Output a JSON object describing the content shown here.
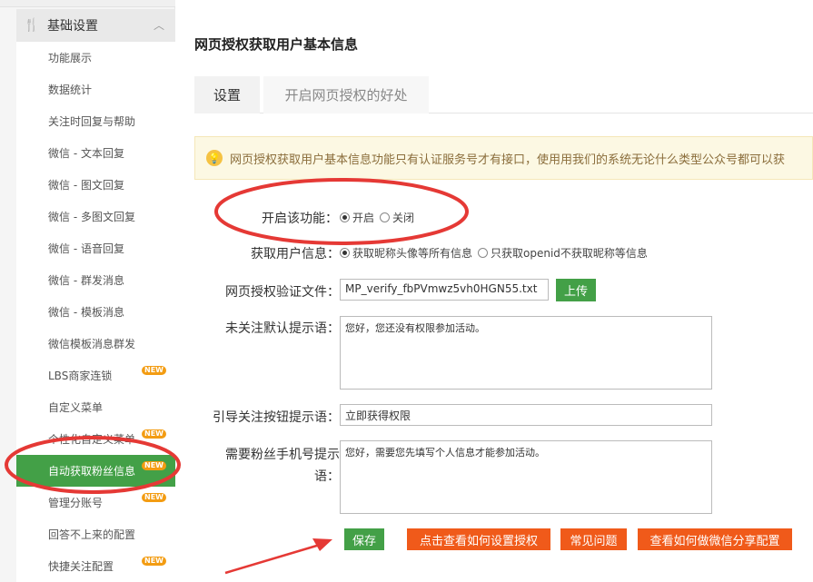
{
  "sidebar": {
    "header_label": "基础设置",
    "items": [
      {
        "label": "功能展示",
        "new": false
      },
      {
        "label": "数据统计",
        "new": false
      },
      {
        "label": "关注时回复与帮助",
        "new": false
      },
      {
        "label": "微信 - 文本回复",
        "new": false
      },
      {
        "label": "微信 - 图文回复",
        "new": false
      },
      {
        "label": "微信 - 多图文回复",
        "new": false
      },
      {
        "label": "微信 - 语音回复",
        "new": false
      },
      {
        "label": "微信 - 群发消息",
        "new": false
      },
      {
        "label": "微信 - 模板消息",
        "new": false
      },
      {
        "label": "微信模板消息群发",
        "new": false
      },
      {
        "label": "LBS商家连锁",
        "new": true
      },
      {
        "label": "自定义菜单",
        "new": false
      },
      {
        "label": "个性化自定义菜单",
        "new": true
      },
      {
        "label": "自动获取粉丝信息",
        "new": true,
        "active": true
      },
      {
        "label": "管理分账号",
        "new": true
      },
      {
        "label": "回答不上来的配置",
        "new": false
      },
      {
        "label": "快捷关注配置",
        "new": true
      }
    ],
    "new_badge": "NEW"
  },
  "main": {
    "title": "网页授权获取用户基本信息",
    "tabs": [
      "设置",
      "开启网页授权的好处"
    ],
    "tip": "网页授权获取用户基本信息功能只有认证服务号才有接口，使用用我们的系统无论什么类型公众号都可以获"
  },
  "form": {
    "enable_label": "开启该功能：",
    "enable_on": "开启",
    "enable_off": "关闭",
    "userinfo_label": "获取用户信息：",
    "userinfo_opt1": "获取昵称头像等所有信息",
    "userinfo_opt2": "只获取openid不获取昵称等信息",
    "verify_label": "网页授权验证文件：",
    "verify_value": "MP_verify_fbPVmwz5vh0HGN55.txt",
    "upload_label": "上传",
    "unfollow_label": "未关注默认提示语：",
    "unfollow_value": "您好，您还没有权限参加活动。",
    "guide_label": "引导关注按钮提示语：",
    "guide_value": "立即获得权限",
    "phone_label_line1": "需要粉丝手机号提示",
    "phone_label_line2": "语：",
    "phone_value": "您好，需要您先填写个人信息才能参加活动。"
  },
  "actions": {
    "save": "保存",
    "howto_auth": "点击查看如何设置授权",
    "faq": "常见问题",
    "howto_share": "查看如何做微信分享配置"
  },
  "colors": {
    "accent_green": "#43a047",
    "accent_orange": "#f05a1a",
    "annotation_red": "#e53935"
  }
}
